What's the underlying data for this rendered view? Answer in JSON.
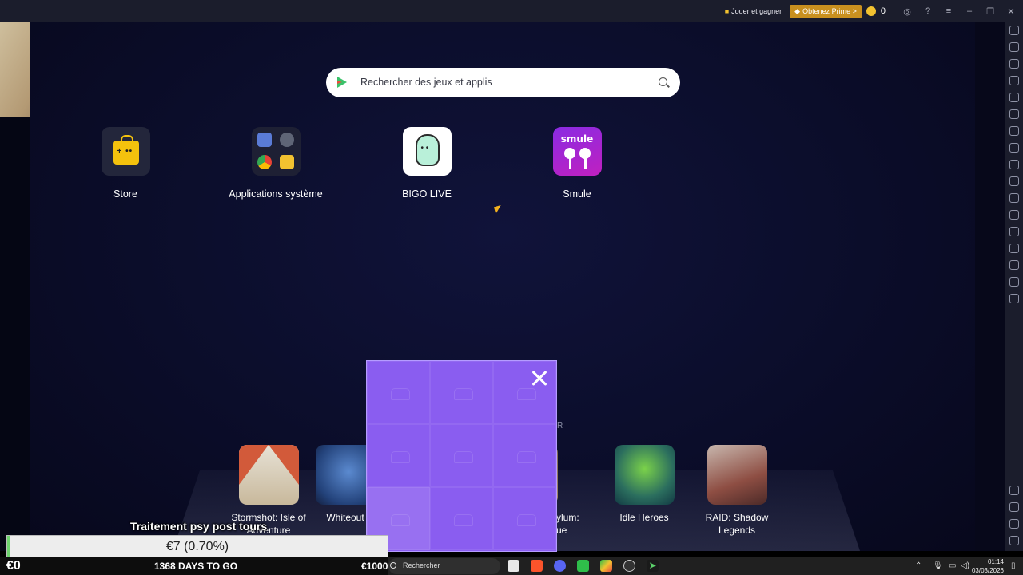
{
  "topbar": {
    "play_and_earn": "Jouer et gagner",
    "get_prime": "Obtenez Prime >",
    "coin_count": "0",
    "icons": [
      "account-icon",
      "help-icon",
      "menu-icon",
      "minimize-icon",
      "restore-icon",
      "close-icon"
    ]
  },
  "search": {
    "placeholder": "Rechercher des jeux et applis"
  },
  "apps": [
    {
      "label": "Store",
      "icon": "store-bag-icon"
    },
    {
      "label": "Applications système",
      "icon": "system-apps-folder-icon"
    },
    {
      "label": "BIGO LIVE",
      "icon": "bigo-live-icon"
    },
    {
      "label": "Smule",
      "icon": "smule-icon"
    }
  ],
  "smule_logo_text": "smule",
  "games": [
    {
      "line1": "Stormshot: Isle of",
      "line2": "Adventure"
    },
    {
      "line1": "Whiteout",
      "line2": ""
    },
    {
      "line1": "ylum:",
      "line2": "ue"
    },
    {
      "line1": "Idle Heroes",
      "line2": ""
    },
    {
      "line1": "RAID: Shadow",
      "line2": "Legends"
    }
  ],
  "ad_partial_text": "R",
  "stream": {
    "title": "Traitement psy post tours",
    "progress_text": "€7 (0.70%)",
    "progress_percent": 0.7,
    "current_amount": "€0",
    "days": "1368 DAYS TO GO",
    "goal": "€1000"
  },
  "taskbar": {
    "search_label": "Rechercher",
    "time": "01:14",
    "date": "03/03/2026"
  },
  "colors": {
    "prime": "#c9901f",
    "ad_purple": "#8a5df0",
    "progress_fill": "#6ed36e"
  }
}
